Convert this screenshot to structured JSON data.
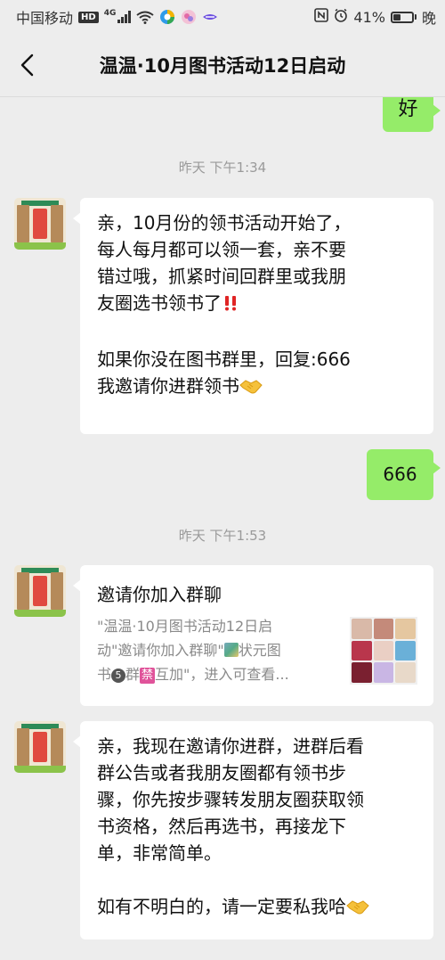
{
  "status_bar": {
    "carrier": "中国移动",
    "hd": "HD",
    "network": "4G",
    "battery_percent": "41%",
    "battery_level": 0.41,
    "extra": "晚",
    "icons": [
      "hd-badge-icon",
      "signal-icon",
      "wifi-icon",
      "app-icon-1",
      "app-icon-2",
      "app-icon-3",
      "nfc-icon",
      "alarm-icon",
      "battery-icon"
    ]
  },
  "header": {
    "title": "温温·10月图书活动12日启动",
    "back_icon": "chevron-left-icon"
  },
  "messages": {
    "m1_text": "好",
    "ts1": "昨天 下午1:34",
    "m2_line1": "亲，10月份的领书活动开始了，",
    "m2_line2": "每人每月都可以领一套，亲不要",
    "m2_line3": "错过哦，抓紧时间回群里或我朋",
    "m2_line4": "友圈选书领书了",
    "m2_line5": "如果你没在图书群里，回复:666",
    "m2_line6": "我邀请你进群领书",
    "m3_text": "666",
    "ts2": "昨天 下午1:53",
    "invite_title": "邀请你加入群聊",
    "invite_line1": "\"温温·10月图书活动12日启",
    "invite_line2a": "动\"邀请你加入群聊\"",
    "invite_line2b": "状元图",
    "invite_line3a": "书",
    "invite_badge_num": "5",
    "invite_line3b": "群",
    "invite_badge_ban": "禁",
    "invite_line3c": "互加\"，进入可查看...",
    "m5_line1": "亲，我现在邀请你进群，进群后看",
    "m5_line2": "群公告或者我朋友圈都有领书步",
    "m5_line3": "骤，你先按步骤转发朋友圈获取领",
    "m5_line4": "书资格，然后再选书，再接龙下",
    "m5_line5": "单，非常简单。",
    "m5_line6": "如有不明白的，请一定要私我哈"
  },
  "colors": {
    "bg": "#ededed",
    "bubble_self": "#95ec69",
    "bubble_other": "#ffffff",
    "timestamp": "#9a9a9a"
  }
}
